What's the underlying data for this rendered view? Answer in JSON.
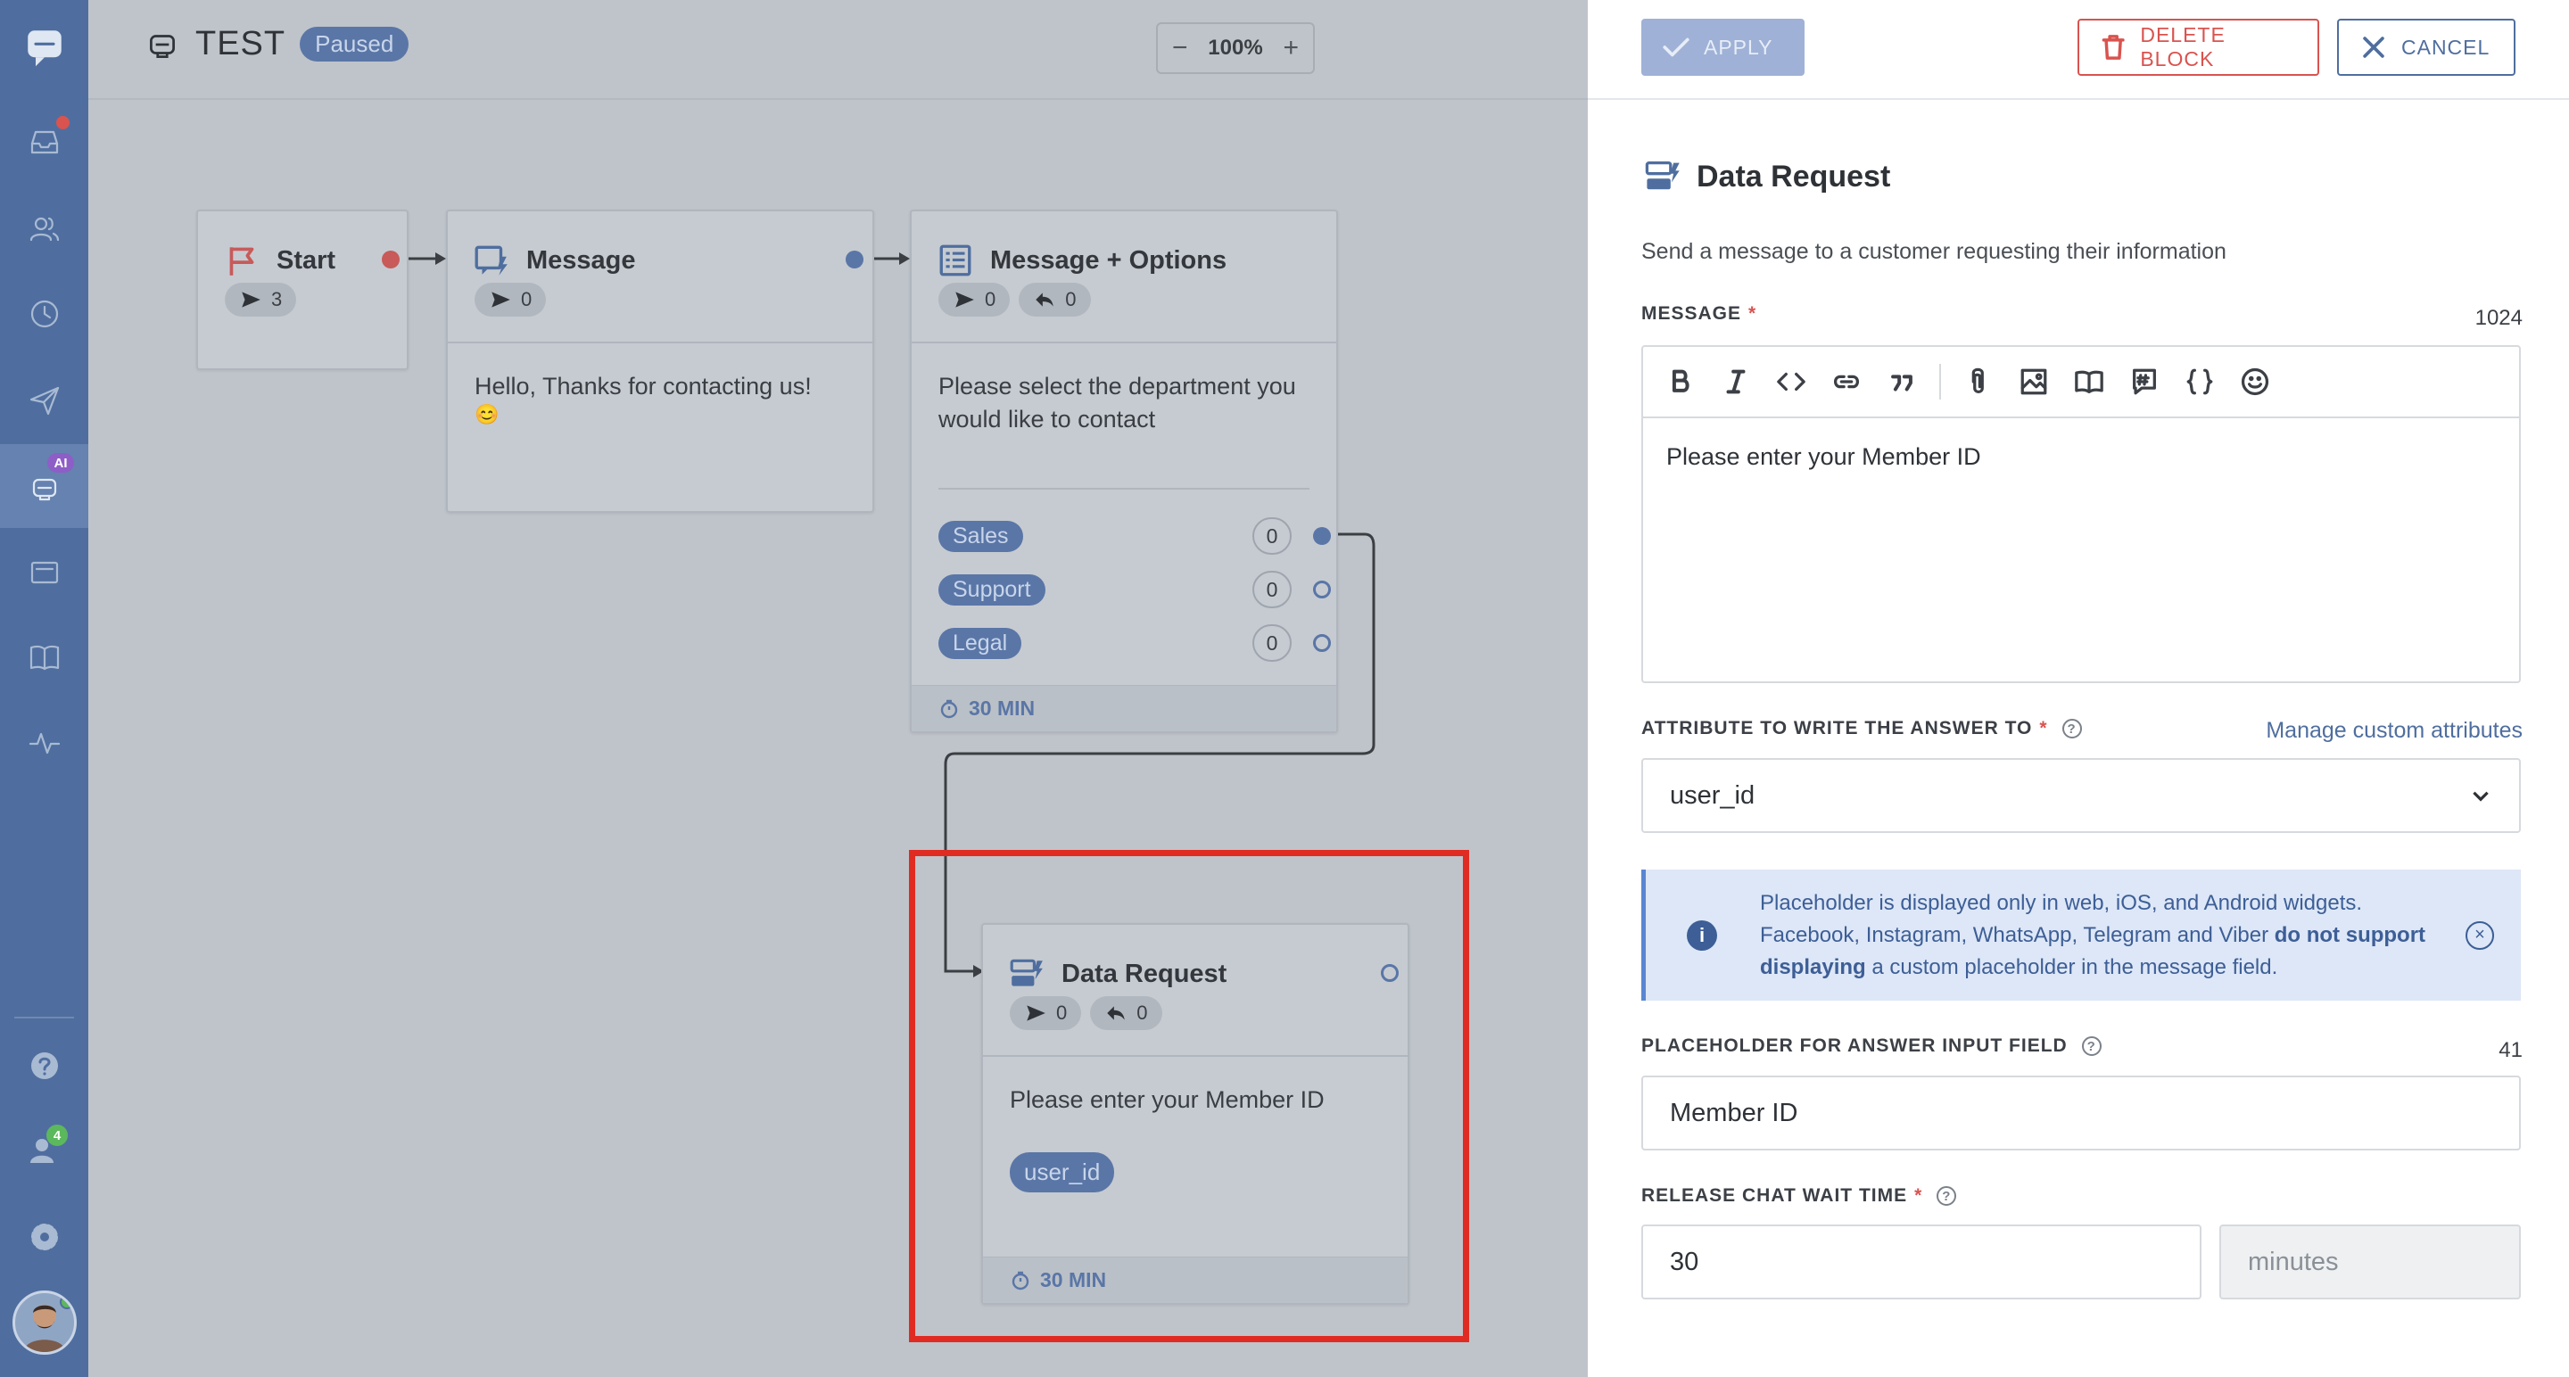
{
  "sidebar": {
    "ai_badge": "AI",
    "notifications_badge": "4",
    "items": [
      "chat-logo",
      "inbox",
      "contacts",
      "history",
      "campaigns",
      "chatbots",
      "tickets",
      "knowledge-base",
      "analytics"
    ],
    "bottom_items": [
      "help",
      "team",
      "settings",
      "profile"
    ]
  },
  "header": {
    "bot_name": "TEST",
    "status": "Paused",
    "zoom": "100%",
    "zoom_out": "−",
    "zoom_in": "+"
  },
  "flow": {
    "start": {
      "title": "Start",
      "sent": "3"
    },
    "message": {
      "title": "Message",
      "sent": "0",
      "text": "Hello, Thanks for contacting us!",
      "emoji": "😊"
    },
    "options": {
      "title": "Message + Options",
      "sent": "0",
      "replied": "0",
      "text": "Please select the department you would like to contact",
      "items": [
        {
          "label": "Sales",
          "count": "0"
        },
        {
          "label": "Support",
          "count": "0"
        },
        {
          "label": "Legal",
          "count": "0"
        }
      ],
      "timeout": "30 MIN"
    },
    "data_request": {
      "title": "Data Request",
      "sent": "0",
      "replied": "0",
      "text": "Please enter your Member ID",
      "attribute": "user_id",
      "timeout": "30 MIN"
    }
  },
  "panel": {
    "apply": "APPLY",
    "delete": "DELETE BLOCK",
    "cancel": "CANCEL",
    "title": "Data Request",
    "description": "Send a message to a customer requesting their information",
    "message_label": "MESSAGE",
    "message_counter": "1024",
    "message_text": "Please enter your Member ID",
    "attribute_label": "ATTRIBUTE TO WRITE THE ANSWER TO",
    "manage_link": "Manage custom attributes",
    "attribute_value": "user_id",
    "info_part1": "Placeholder is displayed only in web, iOS, and Android widgets. Facebook, Instagram, WhatsApp, Telegram and Viber ",
    "info_bold": "do not support displaying",
    "info_part2": " a custom placeholder in the message field.",
    "placeholder_label": "PLACEHOLDER FOR ANSWER INPUT FIELD",
    "placeholder_counter": "41",
    "placeholder_value": "Member ID",
    "wait_label": "RELEASE CHAT WAIT TIME",
    "wait_value": "30",
    "wait_unit": "minutes",
    "required_mark": "*",
    "help_mark": "?",
    "info_mark": "i",
    "close_mark": "×"
  },
  "colors": {
    "sidebar_bg": "#4f6e9f",
    "accent": "#4f6e9f",
    "danger": "#d9534f",
    "highlight": "#e02b23",
    "info_bg": "#dde7f7"
  }
}
